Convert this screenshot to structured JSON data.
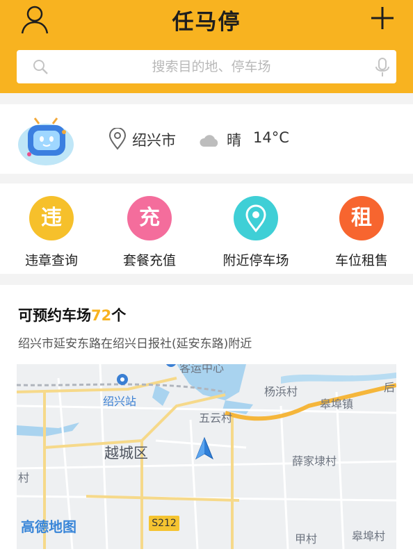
{
  "header": {
    "title": "任马停",
    "user_icon": "user-icon",
    "add_icon": "plus-icon",
    "brand_color": "#f8b320"
  },
  "search": {
    "placeholder": "搜索目的地、停车场",
    "icons": [
      "search-icon",
      "microphone-icon"
    ]
  },
  "info": {
    "city": "绍兴市",
    "weather": "晴",
    "temperature": "14°C",
    "icons": [
      "robot-avatar",
      "location-pin-icon",
      "cloud-icon"
    ]
  },
  "services": [
    {
      "label": "违章查询",
      "glyph": "违",
      "color": "#f6c02b",
      "icon": "violation-icon"
    },
    {
      "label": "套餐充值",
      "glyph": "充",
      "color": "#f46d9c",
      "icon": "recharge-icon"
    },
    {
      "label": "附近停车场",
      "glyph": "",
      "color": "#3fcfd6",
      "icon": "nearby-parking-icon"
    },
    {
      "label": "车位租售",
      "glyph": "租",
      "color": "#f7652f",
      "icon": "rent-icon"
    }
  ],
  "parking": {
    "title_prefix": "可预约车场",
    "count": "72",
    "title_suffix": "个",
    "address": "绍兴市延安东路在绍兴日报社(延安东路)附近"
  },
  "map": {
    "labels": {
      "keyun": "客运中心",
      "yangbin": "杨浜村",
      "shaoxing_station": "绍兴站",
      "gaobu": "皋埠镇",
      "wuyun": "五云村",
      "yuecheng": "越城区",
      "xuejia": "薛家埭村",
      "cun": "村",
      "tian": "甲村",
      "gaobu2": "皋埠村",
      "hou": "后"
    },
    "logo": "高德地图",
    "road_badge": "S212"
  }
}
